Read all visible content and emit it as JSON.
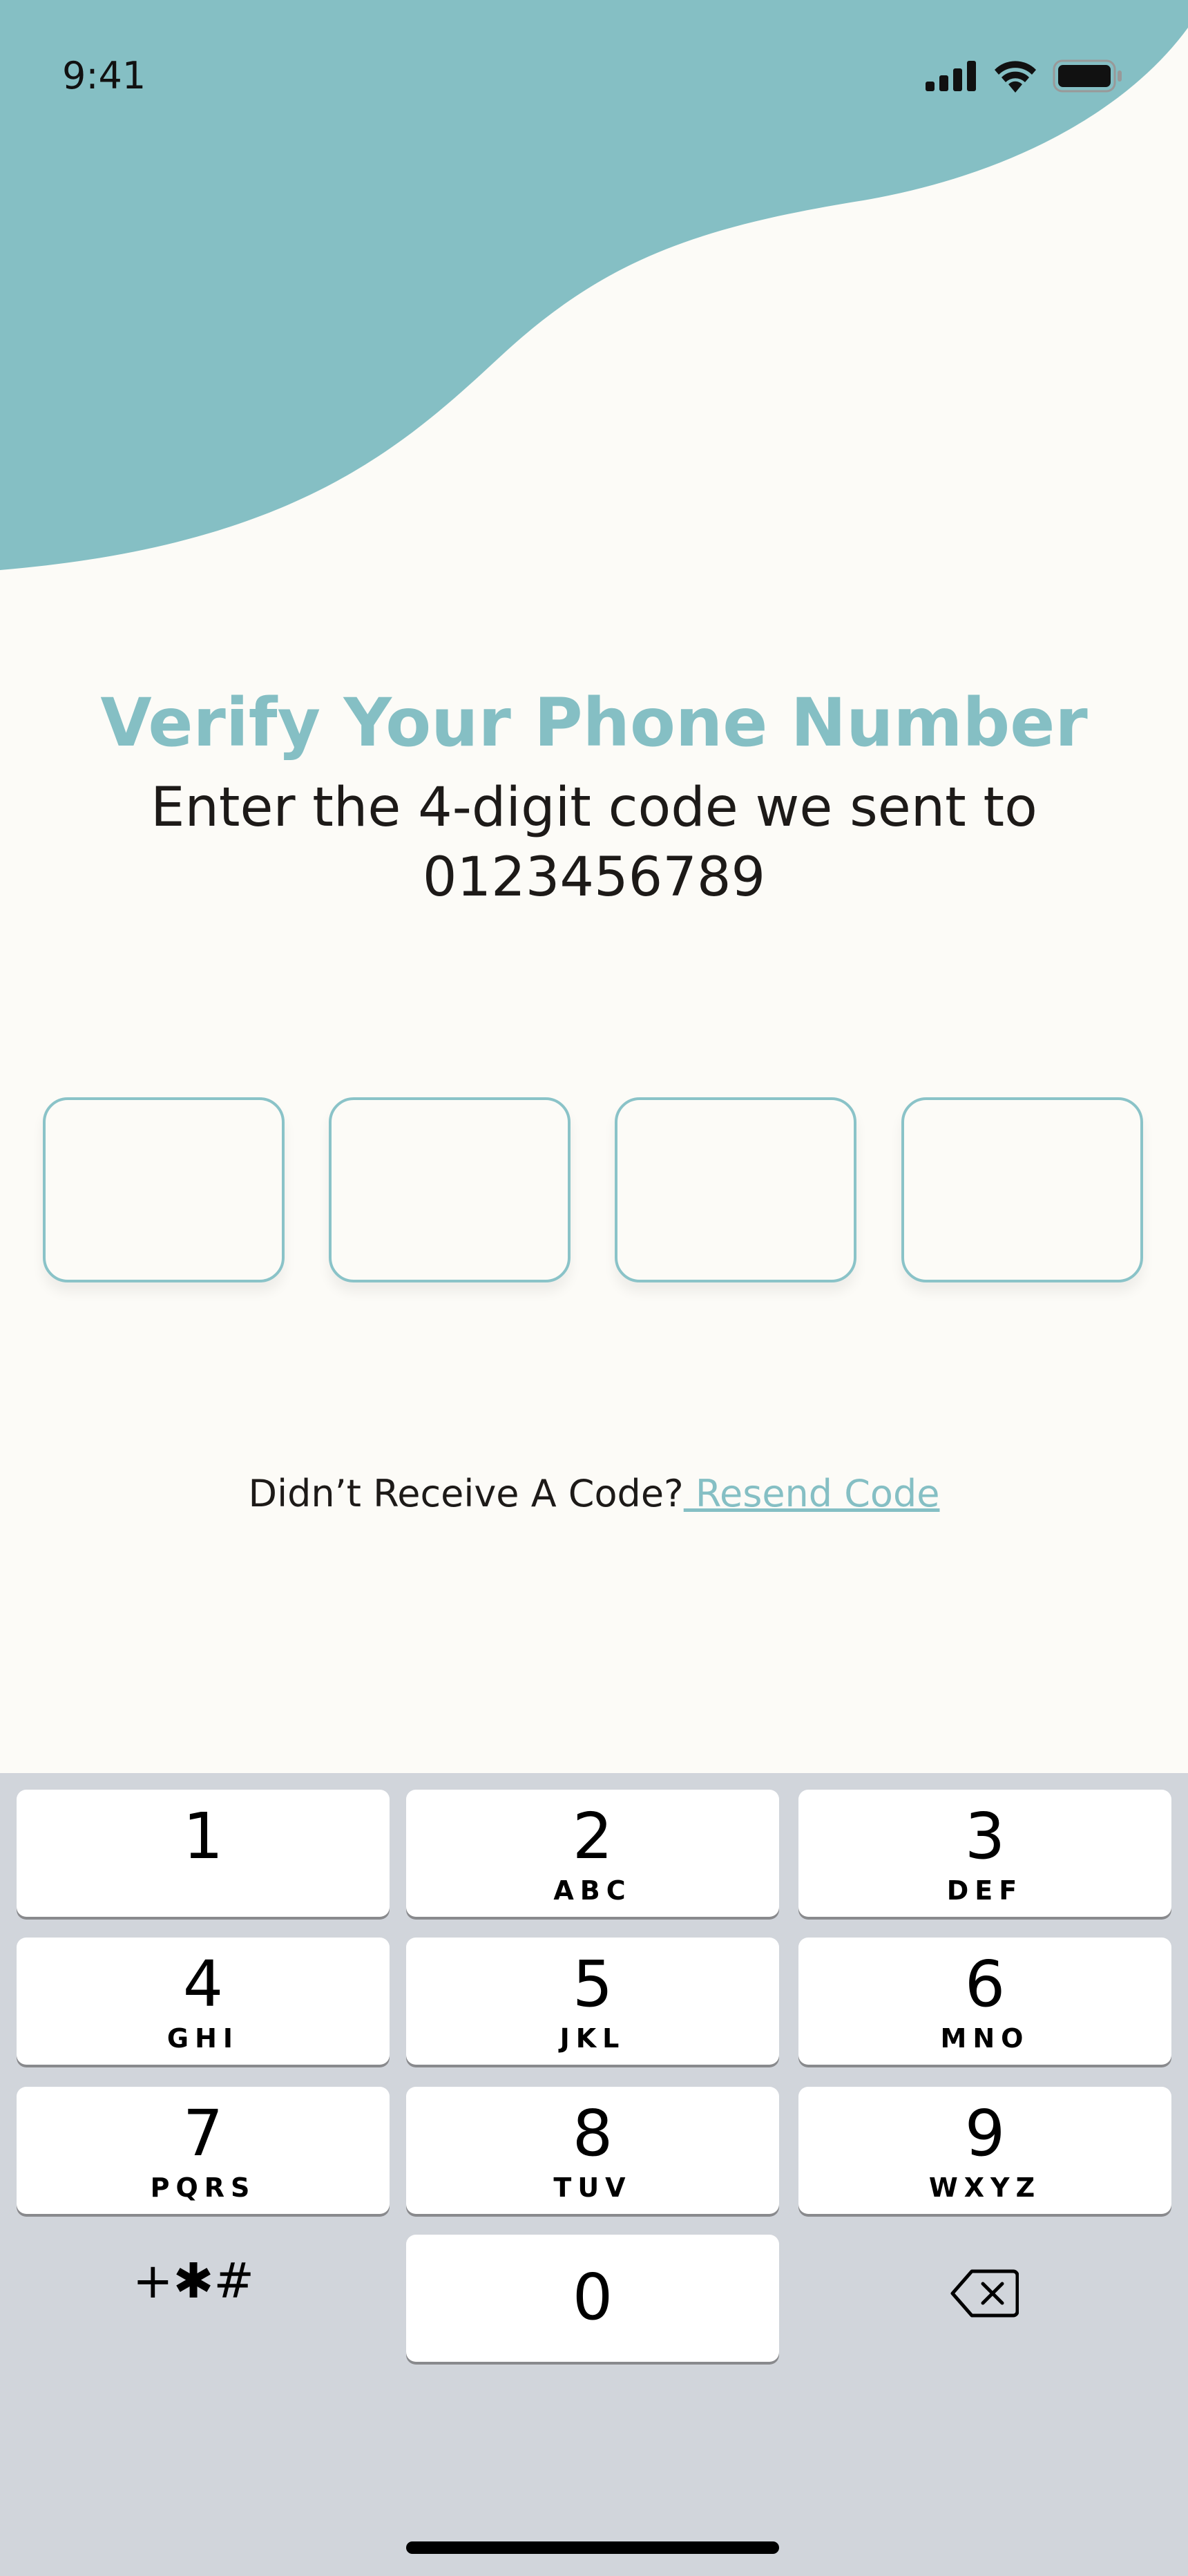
{
  "status_bar": {
    "time": "9:41"
  },
  "colors": {
    "accent": "#85bfc4",
    "background": "#fcfbf7",
    "text": "#1d1a18",
    "keyboard_bg": "#d1d5db"
  },
  "header": {
    "title": "Verify Your Phone Number",
    "subtitle": "Enter the 4-digit code we sent to",
    "phone_number": "0123456789"
  },
  "otp": {
    "digits": [
      "",
      "",
      "",
      ""
    ]
  },
  "resend": {
    "prompt": "Didn’t Receive A Code?",
    "link_label": " Resend Code"
  },
  "keypad": {
    "keys": [
      {
        "num": "1",
        "letters": ""
      },
      {
        "num": "2",
        "letters": "ABC"
      },
      {
        "num": "3",
        "letters": "DEF"
      },
      {
        "num": "4",
        "letters": "GHI"
      },
      {
        "num": "5",
        "letters": "JKL"
      },
      {
        "num": "6",
        "letters": "MNO"
      },
      {
        "num": "7",
        "letters": "PQRS"
      },
      {
        "num": "8",
        "letters": "TUV"
      },
      {
        "num": "9",
        "letters": "WXYZ"
      },
      {
        "num": "0",
        "letters": ""
      }
    ],
    "symbols_label": "+✱#",
    "backspace_icon": "delete-left-icon"
  }
}
